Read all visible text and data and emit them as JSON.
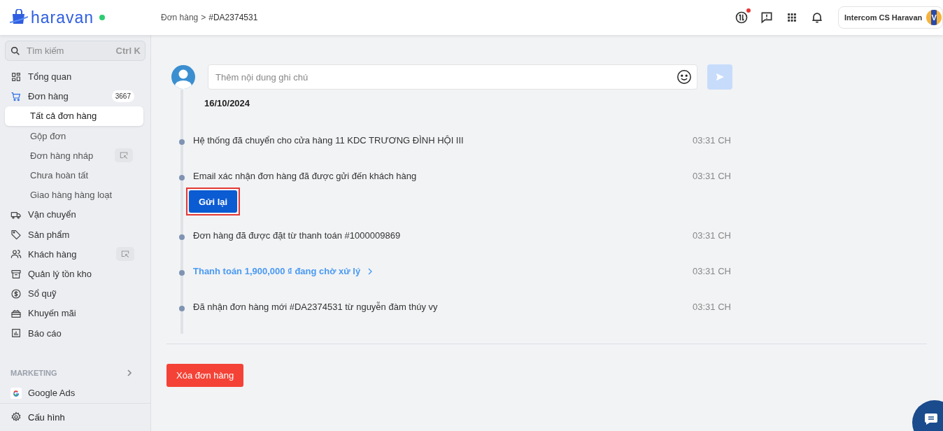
{
  "brand": {
    "name": "haravan",
    "online": true
  },
  "breadcrumb": {
    "parent": "Đơn hàng",
    "separator": ">",
    "current": "#DA2374531"
  },
  "header": {
    "notification_dot": true,
    "account": "Intercom CS Haravan",
    "avatar_initial": "V"
  },
  "search": {
    "placeholder": "Tìm kiếm",
    "shortcut": "Ctrl K"
  },
  "sidebar": {
    "items": [
      {
        "label": "Tổng quan",
        "selected": false
      },
      {
        "label": "Đơn hàng",
        "selected": false,
        "badge": "3667",
        "children": [
          {
            "label": "Tất cả đơn hàng",
            "selected": true
          },
          {
            "label": "Gộp đơn",
            "selected": false
          },
          {
            "label": "Đơn hàng nháp",
            "selected": false,
            "external": true
          },
          {
            "label": "Chưa hoàn tất",
            "selected": false
          },
          {
            "label": "Giao hàng hàng loạt",
            "selected": false
          }
        ]
      },
      {
        "label": "Vận chuyển",
        "selected": false
      },
      {
        "label": "Sản phẩm",
        "selected": false
      },
      {
        "label": "Khách hàng",
        "selected": false,
        "external": true
      },
      {
        "label": "Quản lý tồn kho",
        "selected": false
      },
      {
        "label": "Sổ quỹ",
        "selected": false
      },
      {
        "label": "Khuyến mãi",
        "selected": false
      },
      {
        "label": "Báo cáo",
        "selected": false
      }
    ],
    "section": "MARKETING",
    "section_items": [
      {
        "label": "Google Ads",
        "selected": false
      }
    ],
    "footer_item": {
      "label": "Cấu hình",
      "selected": false
    }
  },
  "history": {
    "note_placeholder": "Thêm nội dung ghi chú",
    "date": "16/10/2024",
    "events": [
      {
        "kind": "text",
        "text": "Hệ thống đã chuyển cho cửa hàng 11 KDC TRƯƠNG ĐÌNH HỘI III",
        "time": "03:31 CH"
      },
      {
        "kind": "action",
        "text": "Email xác nhận đơn hàng đã được gửi đến khách hàng",
        "time": "03:31 CH",
        "button": "Gửi lại",
        "highlighted": true
      },
      {
        "kind": "text",
        "text": "Đơn hàng đã được đặt từ thanh toán #1000009869",
        "time": "03:31 CH"
      },
      {
        "kind": "link",
        "text": "Thanh toán 1,900,000 **₫** đang chờ xử lý",
        "time": "03:31 CH"
      },
      {
        "kind": "text",
        "text": "Đã nhận đơn hàng mới #DA2374531 từ nguyễn đàm thúy vy",
        "time": "03:31 CH"
      }
    ]
  },
  "delete_button": "Xóa đơn hàng"
}
